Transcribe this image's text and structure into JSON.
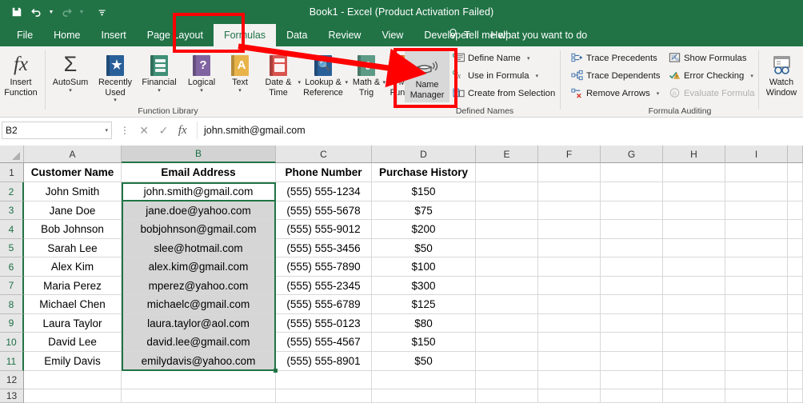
{
  "window": {
    "title": "Book1  -  Excel (Product Activation Failed)",
    "qat": [
      {
        "name": "save-icon",
        "glyph": "save"
      },
      {
        "name": "undo-icon",
        "glyph": "undo"
      },
      {
        "name": "redo-icon",
        "glyph": "redo"
      },
      {
        "name": "customize-quick-access-toolbar-icon",
        "glyph": "customize"
      }
    ]
  },
  "ribbon": {
    "tabs": [
      {
        "label": "File",
        "active": false
      },
      {
        "label": "Home",
        "active": false
      },
      {
        "label": "Insert",
        "active": false
      },
      {
        "label": "Page Layout",
        "active": false
      },
      {
        "label": "Formulas",
        "active": true
      },
      {
        "label": "Data",
        "active": false
      },
      {
        "label": "Review",
        "active": false
      },
      {
        "label": "View",
        "active": false
      },
      {
        "label": "Developer",
        "active": false
      },
      {
        "label": "Help",
        "active": false
      }
    ],
    "tellme": {
      "label": "Tell me what you want to do",
      "icon": "lightbulb-icon"
    },
    "groups": [
      {
        "name": "function-library",
        "label": "Function Library"
      },
      {
        "name": "defined-names",
        "label": "Defined Names"
      },
      {
        "name": "formula-auditing",
        "label": "Formula Auditing"
      }
    ],
    "function_library": [
      {
        "name": "insert-function",
        "line1": "Insert",
        "line2": "Function",
        "icon": "fx-icon",
        "color": "#3a3a3a",
        "caret": false
      },
      {
        "name": "autosum",
        "line1": "AutoSum",
        "line2": "",
        "icon": "sigma-icon",
        "color": "#3a3a3a",
        "caret": true
      },
      {
        "name": "recently-used",
        "line1": "Recently",
        "line2": "Used",
        "icon": "book-star-icon",
        "color": "#2a6099",
        "caret": true
      },
      {
        "name": "financial",
        "line1": "Financial",
        "line2": "",
        "icon": "book-money-icon",
        "color": "#3f8f77",
        "caret": true
      },
      {
        "name": "logical",
        "line1": "Logical",
        "line2": "",
        "icon": "book-question-icon",
        "color": "#8064a2",
        "caret": true
      },
      {
        "name": "text",
        "line1": "Text",
        "line2": "",
        "icon": "book-a-icon",
        "color": "#e8b44a",
        "caret": true
      },
      {
        "name": "date-time",
        "line1": "Date &",
        "line2": "Time",
        "icon": "book-calendar-icon",
        "color": "#d9534f",
        "caret": true
      },
      {
        "name": "lookup-reference",
        "line1": "Lookup &",
        "line2": "Reference",
        "icon": "book-search-icon",
        "color": "#2a6099",
        "caret": true
      },
      {
        "name": "math-trig",
        "line1": "Math &",
        "line2": "Trig",
        "icon": "book-theta-icon",
        "color": "#5d9b86",
        "caret": true
      },
      {
        "name": "more-functions",
        "line1": "More",
        "line2": "Functions",
        "icon": "book-more-icon",
        "color": "#e8822b",
        "caret": true
      }
    ],
    "defined_names": {
      "name_manager": {
        "line1": "Name",
        "line2": "Manager",
        "icon": "name-manager-icon"
      },
      "items": [
        {
          "name": "define-name",
          "label": "Define Name",
          "icon": "define-name-icon",
          "caret": true,
          "disabled": false
        },
        {
          "name": "use-in-formula",
          "label": "Use in Formula",
          "icon": "use-in-formula-icon",
          "caret": true,
          "disabled": false
        },
        {
          "name": "create-from-selection",
          "label": "Create from Selection",
          "icon": "create-from-selection-icon",
          "caret": false,
          "disabled": false
        }
      ]
    },
    "formula_auditing": {
      "col1": [
        {
          "name": "trace-precedents",
          "label": "Trace Precedents",
          "icon": "trace-precedents-icon",
          "caret": false,
          "disabled": false
        },
        {
          "name": "trace-dependents",
          "label": "Trace Dependents",
          "icon": "trace-dependents-icon",
          "caret": false,
          "disabled": false
        },
        {
          "name": "remove-arrows",
          "label": "Remove Arrows",
          "icon": "remove-arrows-icon",
          "caret": true,
          "disabled": false
        }
      ],
      "col2": [
        {
          "name": "show-formulas",
          "label": "Show Formulas",
          "icon": "show-formulas-icon",
          "caret": false,
          "disabled": false
        },
        {
          "name": "error-checking",
          "label": "Error Checking",
          "icon": "error-checking-icon",
          "caret": true,
          "disabled": false
        },
        {
          "name": "evaluate-formula",
          "label": "Evaluate Formula",
          "icon": "evaluate-formula-icon",
          "caret": false,
          "disabled": true
        }
      ],
      "watch_window": {
        "line1": "Watch",
        "line2": "Window",
        "icon": "watch-window-icon"
      }
    }
  },
  "formula_bar": {
    "name_box_value": "B2",
    "cancel_icon": "cancel-icon",
    "enter_icon": "enter-icon",
    "fx_icon": "insert-function-icon",
    "value": "john.smith@gmail.com"
  },
  "sheet": {
    "columns": [
      "A",
      "B",
      "C",
      "D",
      "E",
      "F",
      "G",
      "H",
      "I"
    ],
    "selected_column": "B",
    "rows": [
      "1",
      "2",
      "3",
      "4",
      "5",
      "6",
      "7",
      "8",
      "9",
      "10",
      "11",
      "12",
      "13"
    ],
    "selected_rows": [
      "2",
      "3",
      "4",
      "5",
      "6",
      "7",
      "8",
      "9",
      "10",
      "11"
    ],
    "active_cell": "B2",
    "headers": [
      "Customer Name",
      "Email Address",
      "Phone Number",
      "Purchase History"
    ],
    "data": [
      [
        "John Smith",
        "john.smith@gmail.com",
        "(555) 555-1234",
        "$150"
      ],
      [
        "Jane Doe",
        "jane.doe@yahoo.com",
        "(555) 555-5678",
        "$75"
      ],
      [
        "Bob Johnson",
        "bobjohnson@gmail.com",
        "(555) 555-9012",
        "$200"
      ],
      [
        "Sarah Lee",
        "slee@hotmail.com",
        "(555) 555-3456",
        "$50"
      ],
      [
        "Alex Kim",
        "alex.kim@gmail.com",
        "(555) 555-7890",
        "$100"
      ],
      [
        "Maria Perez",
        "mperez@yahoo.com",
        "(555) 555-2345",
        "$300"
      ],
      [
        "Michael Chen",
        "michaelc@gmail.com",
        "(555) 555-6789",
        "$125"
      ],
      [
        "Laura Taylor",
        "laura.taylor@aol.com",
        "(555) 555-0123",
        "$80"
      ],
      [
        "David Lee",
        "david.lee@gmail.com",
        "(555) 555-4567",
        "$150"
      ],
      [
        "Emily Davis",
        "emilydavis@yahoo.com",
        "(555) 555-8901",
        "$50"
      ]
    ]
  },
  "annotations": {
    "color": "#ff0000",
    "boxes": [
      {
        "name": "formulas-tab-highlight"
      },
      {
        "name": "name-manager-highlight"
      }
    ],
    "arrow": {
      "name": "pointer-arrow"
    }
  }
}
